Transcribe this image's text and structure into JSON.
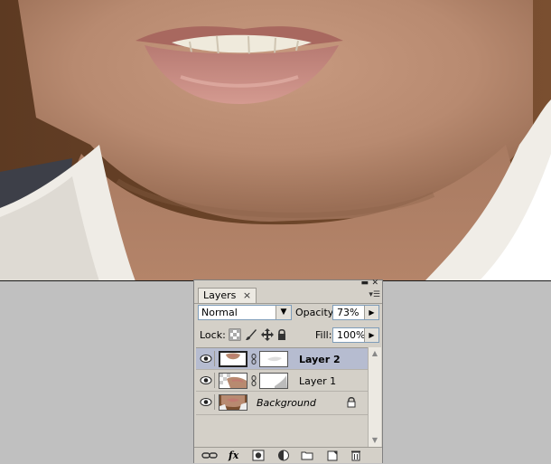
{
  "panel": {
    "tab_label": "Layers",
    "tab_close": "×",
    "blend_mode": "Normal",
    "opacity_label": "Opacity:",
    "opacity_value": "73%",
    "lock_label": "Lock:",
    "fill_label": "Fill:",
    "fill_value": "100%",
    "layers": [
      {
        "name": "Layer 2",
        "selected": true,
        "visible": true,
        "has_mask": true
      },
      {
        "name": "Layer 1",
        "selected": false,
        "visible": true,
        "has_mask": true
      },
      {
        "name": "Background",
        "selected": false,
        "visible": true,
        "has_mask": false,
        "locked": true
      }
    ],
    "icons": {
      "lock_transparent": "checkerboard-icon",
      "lock_image": "brush-icon",
      "lock_position": "move-icon",
      "lock_all": "lock-icon",
      "bottom": [
        "link-icon",
        "fx-icon",
        "mask-icon",
        "adjustment-icon",
        "folder-icon",
        "new-layer-icon",
        "trash-icon"
      ]
    },
    "fx_text": "fx"
  }
}
